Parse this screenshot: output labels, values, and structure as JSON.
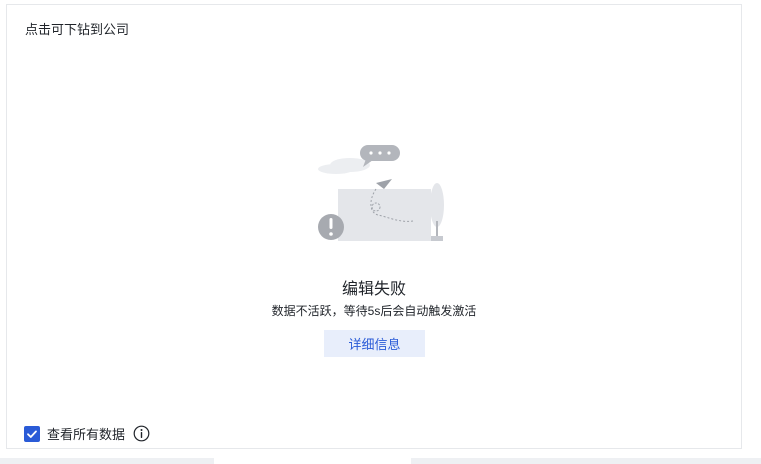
{
  "panel": {
    "title": "点击可下钻到公司"
  },
  "empty_state": {
    "illustration": "error-illustration",
    "title": "编辑失败",
    "description": "数据不活跃，等待5s后会自动触发激活",
    "detail_button_label": "详细信息"
  },
  "footer": {
    "view_all_label": "查看所有数据",
    "view_all_checked": true,
    "info_icon": "info-circle-icon"
  },
  "colors": {
    "accent": "#2a5bd7",
    "button_bg": "#e8eefb"
  }
}
